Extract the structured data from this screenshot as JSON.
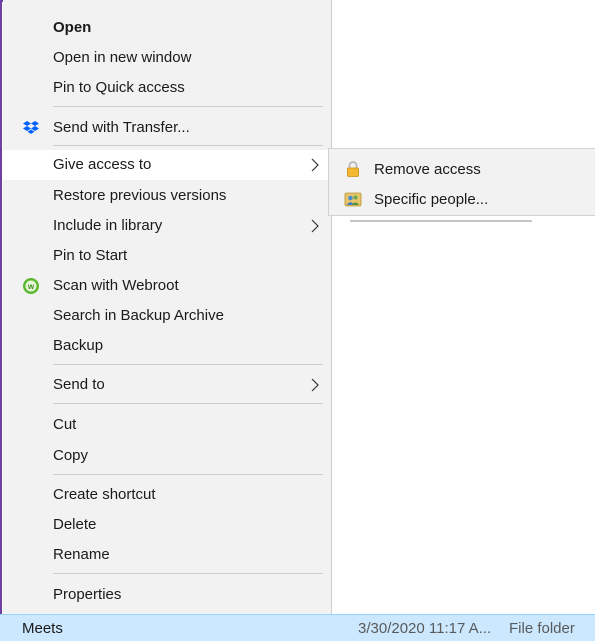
{
  "context_menu": {
    "items": [
      {
        "label": "Open"
      },
      {
        "label": "Open in new window"
      },
      {
        "label": "Pin to Quick access"
      },
      {
        "label": "Send with Transfer...",
        "icon": "dropbox-icon"
      },
      {
        "label": "Give access to",
        "has_submenu": true
      },
      {
        "label": "Restore previous versions"
      },
      {
        "label": "Include in library",
        "has_submenu": true
      },
      {
        "label": "Pin to Start"
      },
      {
        "label": "Scan with Webroot",
        "icon": "webroot-icon"
      },
      {
        "label": "Search in Backup Archive"
      },
      {
        "label": "Backup"
      },
      {
        "label": "Send to",
        "has_submenu": true
      },
      {
        "label": "Cut"
      },
      {
        "label": "Copy"
      },
      {
        "label": "Create shortcut"
      },
      {
        "label": "Delete"
      },
      {
        "label": "Rename"
      },
      {
        "label": "Properties"
      }
    ]
  },
  "submenu": {
    "items": [
      {
        "label": "Remove access",
        "icon": "lock-icon"
      },
      {
        "label": "Specific people...",
        "icon": "people-icon"
      }
    ]
  },
  "file_row": {
    "name": "Meets",
    "date_modified": "3/30/2020 11:17 A...",
    "type": "File folder"
  },
  "colors": {
    "menu_bg": "#f2f2f2",
    "selection_bg": "#cce8ff",
    "frame_border": "#6f3fa6",
    "dropbox_blue": "#0061fe",
    "webroot_green": "#5cb82e"
  }
}
